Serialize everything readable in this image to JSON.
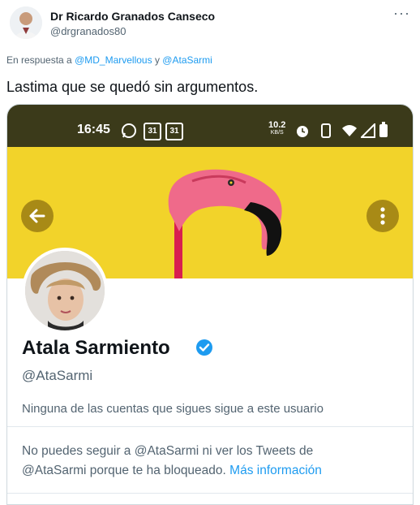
{
  "author": {
    "name": "Dr Ricardo Granados Canseco",
    "handle": "@drgranados80",
    "more_icon": "more-icon"
  },
  "reply": {
    "prefix": "En respuesta a",
    "mention1": "@MD_Marvellous",
    "connector": "y",
    "mention2": "@AtaSarmi"
  },
  "tweet": {
    "text": "Lastima que se quedó sin argumentos."
  },
  "screenshot": {
    "statusbar": {
      "time": "16:45",
      "badge1": "31",
      "badge2": "31",
      "speed_top": "10.2",
      "speed_bottom": "KB/S"
    },
    "profile": {
      "name": "Atala Sarmiento",
      "handle": "@AtaSarmi",
      "follow_note": "Ninguna de las cuentas que sigues sigue a este usuario",
      "blocked_line1": "No puedes seguir a @AtaSarmi ni ver los Tweets de",
      "blocked_line2": "@AtaSarmi porque te ha bloqueado.",
      "more_info": "Más información"
    }
  },
  "colors": {
    "banner": "#f2d32a",
    "link": "#1d9bf0",
    "muted": "#536471",
    "statusbar": "#3b3a1a"
  }
}
